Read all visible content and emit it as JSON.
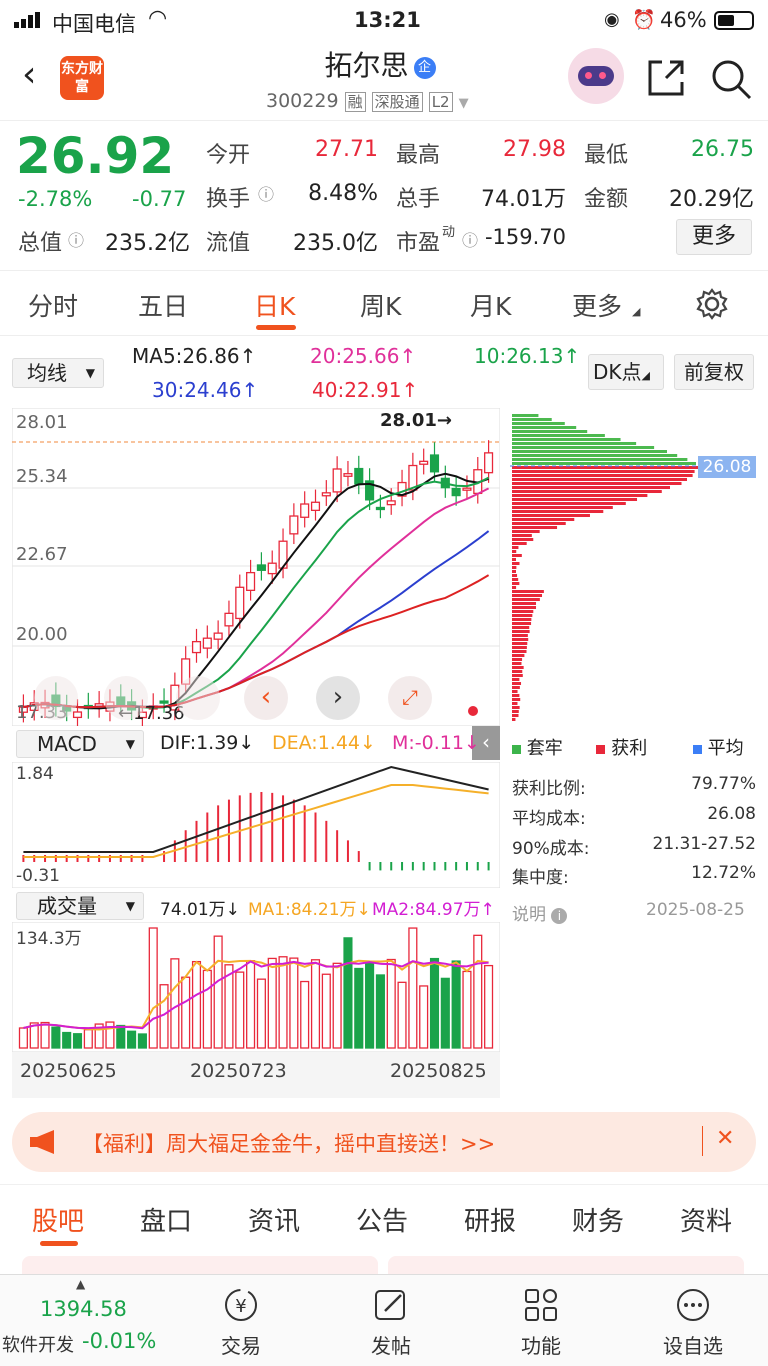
{
  "status": {
    "carrier": "中国电信",
    "time": "13:21",
    "battery": "46%"
  },
  "header": {
    "app_logo": "东方财富",
    "stock_name": "拓尔思",
    "badge": "企",
    "code": "300229",
    "tag1": "融",
    "tag2": "深股通",
    "tag3": "L2"
  },
  "quote": {
    "price": "26.92",
    "change_pct": "-2.78%",
    "change": "-0.77",
    "open_label": "今开",
    "open": "27.71",
    "high_label": "最高",
    "high": "27.98",
    "low_label": "最低",
    "low": "26.75",
    "turnover_label": "换手",
    "turnover": "8.48%",
    "volume_label": "总手",
    "volume": "74.01万",
    "amount_label": "金额",
    "amount": "20.29亿",
    "mcap_label": "总值",
    "mcap": "235.2亿",
    "float_label": "流值",
    "float": "235.0亿",
    "pe_label": "市盈",
    "pe_sup": "动",
    "pe": "-159.70",
    "more": "更多"
  },
  "tabs": [
    "分时",
    "五日",
    "日K",
    "周K",
    "月K",
    "更多"
  ],
  "active_tab": "日K",
  "ma": {
    "select": "均线",
    "ma5": "MA5:26.86↑",
    "ma20": "20:25.66↑",
    "ma10": "10:26.13↑",
    "ma30": "30:24.46↑",
    "ma40": "40:22.91↑",
    "dk": "DK点",
    "fq": "前复权"
  },
  "chart_labels": {
    "y1": "28.01",
    "y2": "25.34",
    "y3": "22.67",
    "y4": "20.00",
    "y5": "17.33",
    "high_mark": "28.01→",
    "low_mark": "←17.36",
    "avg_cost_tag": "26.08"
  },
  "macd": {
    "select": "MACD",
    "dif": "DIF:1.39↓",
    "dea": "DEA:1.44↓",
    "m": "M:-0.11↓",
    "top": "1.84",
    "bottom": "-0.31"
  },
  "vol": {
    "select": "成交量",
    "val": "74.01万↓",
    "ma1": "MA1:84.21万↓",
    "ma2": "MA2:84.97万↑",
    "top": "134.3万"
  },
  "dates": [
    "20250625",
    "20250723",
    "20250825"
  ],
  "chip": {
    "legend": [
      "套牢",
      "获利",
      "平均"
    ],
    "rows": [
      {
        "label": "获利比例:",
        "value": "79.77%"
      },
      {
        "label": "平均成本:",
        "value": "26.08"
      },
      {
        "label": "90%成本:",
        "value": "21.31-27.52"
      },
      {
        "label": "集中度:",
        "value": "12.72%"
      }
    ],
    "note": "说明",
    "date": "2025-08-25"
  },
  "banner": {
    "text": "【福利】周大福足金金牛，摇中直接送！>>"
  },
  "section_tabs": [
    "股吧",
    "盘口",
    "资讯",
    "公告",
    "研报",
    "财务",
    "资料"
  ],
  "index": {
    "value": "1394.58",
    "name": "软件开发",
    "change": "-0.01%"
  },
  "nav": [
    "交易",
    "发帖",
    "功能",
    "设自选"
  ],
  "colors": {
    "up": "#e8283a",
    "down": "#1aa34a",
    "accent": "#f0521e"
  }
}
